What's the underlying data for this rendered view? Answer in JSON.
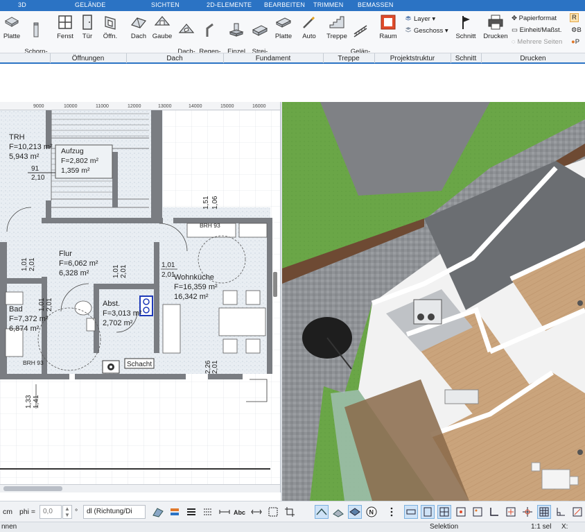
{
  "ribbon": {
    "tabs": [
      "3D",
      "GELÄNDE",
      "SICHTEN",
      "2D-ELEMENTE",
      "BEARBEITEN",
      "TRIMMEN",
      "BEMASSEN"
    ],
    "buttons": {
      "platte1": "Platte",
      "schornstein": "Schorn-\nstein",
      "fenster": "Fenst",
      "tuer": "Tür",
      "oeffnung": "Öffn.",
      "dach": "Dach",
      "gaube": "Gaube",
      "dachfenster": "Dach-\nfenster",
      "regenfallrohr": "Regen-\nfallrohr",
      "einzelfund": "Einzel\nFund.",
      "streifen": "Strei-\nfen",
      "platte2": "Platte",
      "auto": "Auto",
      "treppe": "Treppe",
      "gelaender": "Gelän-\nder",
      "raum": "Raum",
      "schnitt": "Schnitt",
      "drucken": "Drucken"
    },
    "small": {
      "layer": "Layer",
      "geschoss": "Geschoss",
      "papierformat": "Papierformat",
      "einheit": "Einheit/Maßst.",
      "mehrere_seiten": "Mehrere Seiten",
      "r_clip": "R",
      "b_clip": "B",
      "p_clip": "P"
    },
    "groups": [
      "Öffnungen",
      "Dach",
      "Fundament",
      "Treppe",
      "Projektstruktur",
      "Schnitt",
      "Drucken"
    ]
  },
  "ruler": {
    "ticks": [
      "9000",
      "10000",
      "11000",
      "12000",
      "13000",
      "14000",
      "15000",
      "16000"
    ]
  },
  "plan": {
    "rooms": [
      {
        "name": "TRH",
        "line1": "F=10,213 m²",
        "line2": "5,943 m²"
      },
      {
        "name": "Aufzug",
        "line1": "F=2,802 m²",
        "line2": "1,359 m²"
      },
      {
        "name": "Flur",
        "line1": "F=6,062 m²",
        "line2": "6,328 m²"
      },
      {
        "name": "Wohnküche",
        "line1": "F=16,359 m²",
        "line2": "16,342 m²"
      },
      {
        "name": "Bad",
        "line1": "F=7,372 m²",
        "line2": "6,874 m²"
      },
      {
        "name": "Abst.",
        "line1": "F=3,013 m²",
        "line2": "2,702 m²"
      }
    ],
    "labels": {
      "d91": "91",
      "d210": "2,10",
      "brh93a": "BRH 93",
      "brh93b": "BRH 93",
      "schacht": "Schacht",
      "d151": "1,51",
      "d106": "1,06",
      "d101a": "1,01",
      "d201a": "2,01",
      "d101b": "1,01",
      "d201b": "2,01",
      "d101c": "1,01",
      "d201c": "2,01",
      "d101d": "1,01",
      "d201d": "2,01",
      "d201e": "2,01",
      "d226": "2,26",
      "d141": "1,41",
      "d133": "1,33"
    }
  },
  "toolbar": {
    "unit": "cm",
    "phi_label": "phi =",
    "phi_value": "0,0",
    "phi_unit": "°",
    "dl_select": "dl (Richtung/Di"
  },
  "status": {
    "left": "nnen",
    "mode": "Selektion",
    "scale": "1:1 sel",
    "coord": "X:"
  },
  "colors": {
    "accent": "#2b73c4",
    "grass": "#6aa647",
    "paving": "#8f9296",
    "floor_wood": "#c9a27a",
    "wall": "#ffffff"
  }
}
